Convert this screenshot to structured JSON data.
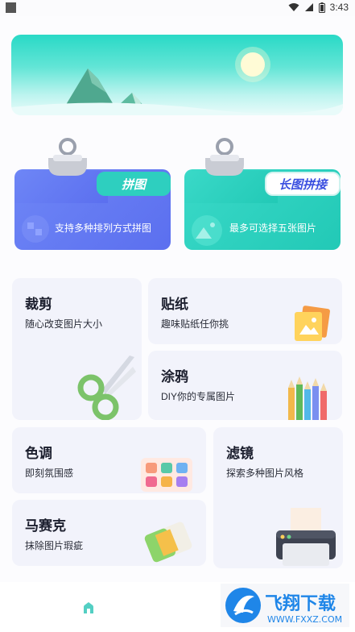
{
  "status_bar": {
    "time": "3:43"
  },
  "featured": [
    {
      "tag": "拼图",
      "description": "支持多种排列方式拼图"
    },
    {
      "tag": "长图拼接",
      "description": "最多可选择五张图片"
    }
  ],
  "tools": {
    "crop": {
      "title": "裁剪",
      "subtitle": "随心改变图片大小"
    },
    "sticker": {
      "title": "贴纸",
      "subtitle": "趣味贴纸任你挑"
    },
    "doodle": {
      "title": "涂鸦",
      "subtitle": "DIY你的专属图片"
    },
    "tone": {
      "title": "色调",
      "subtitle": "即刻氛围感"
    },
    "filter": {
      "title": "滤镜",
      "subtitle": "探索多种图片风格"
    },
    "mosaic": {
      "title": "马赛克",
      "subtitle": "抹除图片瑕疵"
    }
  },
  "watermark": {
    "text_main": "飞翔下载",
    "text_url": "WWW.FXXZ.COM"
  },
  "colors": {
    "blue_folder": "#5b6fef",
    "teal_folder": "#22c9b6",
    "tile_bg": "#f2f3fb"
  }
}
